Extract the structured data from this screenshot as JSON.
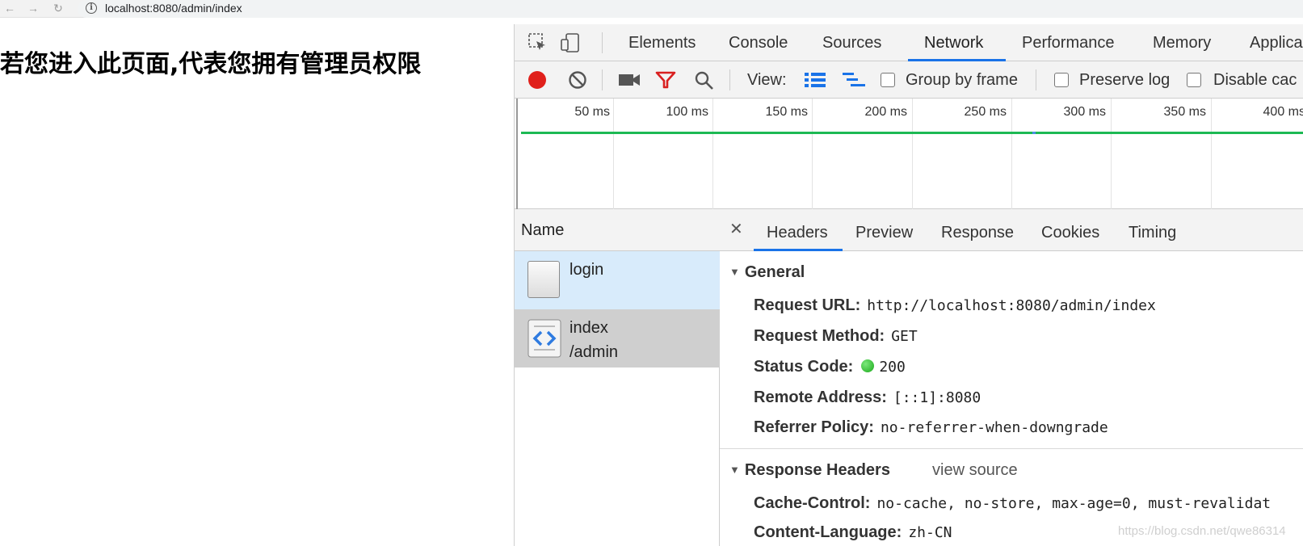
{
  "browser": {
    "url": "localhost:8080/admin/index"
  },
  "page": {
    "heading": "若您进入此页面,代表您拥有管理员权限"
  },
  "devtools": {
    "tabs": [
      "Elements",
      "Console",
      "Sources",
      "Network",
      "Performance",
      "Memory",
      "Applica"
    ],
    "active_tab": "Network",
    "toolbar": {
      "view_label": "View:",
      "group_by_frame": "Group by frame",
      "preserve_log": "Preserve log",
      "disable_cache": "Disable cac"
    },
    "timeline_labels": [
      "50 ms",
      "100 ms",
      "150 ms",
      "200 ms",
      "250 ms",
      "300 ms",
      "350 ms",
      "400 ms"
    ],
    "requests": {
      "header": "Name",
      "items": [
        {
          "name": "login",
          "path": ""
        },
        {
          "name": "index",
          "path": "/admin"
        }
      ]
    },
    "detail": {
      "tabs": [
        "Headers",
        "Preview",
        "Response",
        "Cookies",
        "Timing"
      ],
      "active_tab": "Headers",
      "general_title": "General",
      "general": [
        {
          "key": "Request URL:",
          "value": "http://localhost:8080/admin/index"
        },
        {
          "key": "Request Method:",
          "value": "GET"
        },
        {
          "key": "Status Code:",
          "value": "200"
        },
        {
          "key": "Remote Address:",
          "value": "[::1]:8080"
        },
        {
          "key": "Referrer Policy:",
          "value": "no-referrer-when-downgrade"
        }
      ],
      "response_headers_title": "Response Headers",
      "view_source": "view source",
      "response_headers": [
        {
          "key": "Cache-Control:",
          "value": "no-cache, no-store, max-age=0, must-revalidat"
        },
        {
          "key": "Content-Language:",
          "value": "zh-CN"
        }
      ]
    }
  },
  "watermark": "https://blog.csdn.net/qwe86314",
  "colors": {
    "accent": "#1a73e8",
    "record": "#e0201b",
    "filter": "#d92020",
    "timeline_bar": "#1db954",
    "selected_row": "#d8ebfb"
  }
}
